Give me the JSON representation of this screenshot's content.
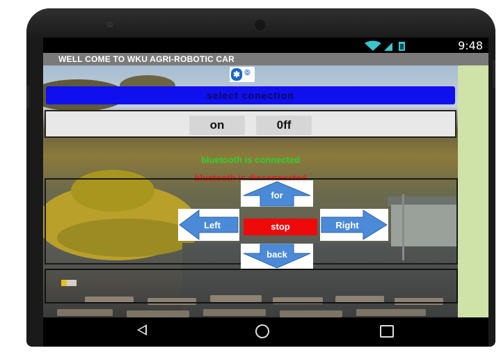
{
  "status_bar": {
    "time": "9:48",
    "icons": [
      "wifi-icon",
      "signal-icon",
      "battery-icon"
    ]
  },
  "app": {
    "title": "WELL COME TO WKU AGRI-ROBOTIC CAR",
    "select_connection_label": "select conection",
    "on_label": "on",
    "off_label": "0ff",
    "connected_text": "bluetooth is connected",
    "disconnected_text": "bluetooth is disconnected",
    "controls": {
      "forward_label": "for",
      "left_label": "Left",
      "stop_label": "stop",
      "right_label": "Right",
      "back_label": "back"
    }
  },
  "colors": {
    "select_button": "#1010ee",
    "stop_button": "#ee0a0a",
    "connected": "#2ed12e",
    "disconnected": "#ee1a1a",
    "arrow": "#4b8ad6"
  },
  "nav": {
    "icons": [
      "back-icon",
      "home-icon",
      "recents-icon"
    ]
  }
}
